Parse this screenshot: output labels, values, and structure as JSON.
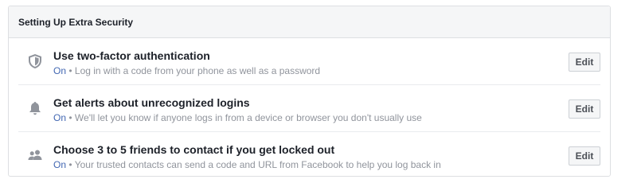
{
  "panel": {
    "title": "Setting Up Extra Security",
    "items": [
      {
        "icon": "shield-icon",
        "heading": "Use two-factor authentication",
        "status": "On",
        "separator": "•",
        "description": "Log in with a code from your phone as well as a password",
        "action_label": "Edit"
      },
      {
        "icon": "bell-icon",
        "heading": "Get alerts about unrecognized logins",
        "status": "On",
        "separator": "•",
        "description": "We'll let you know if anyone logs in from a device or browser you don't usually use",
        "action_label": "Edit"
      },
      {
        "icon": "friends-icon",
        "heading": "Choose 3 to 5 friends to contact if you get locked out",
        "status": "On",
        "separator": "•",
        "description": "Your trusted contacts can send a code and URL from Facebook to help you log back in",
        "action_label": "Edit"
      }
    ]
  },
  "colors": {
    "status": "#4267b2",
    "muted_text": "#90949c",
    "icon": "#90949c",
    "border": "#dddfe2",
    "header_bg": "#f5f6f7"
  }
}
